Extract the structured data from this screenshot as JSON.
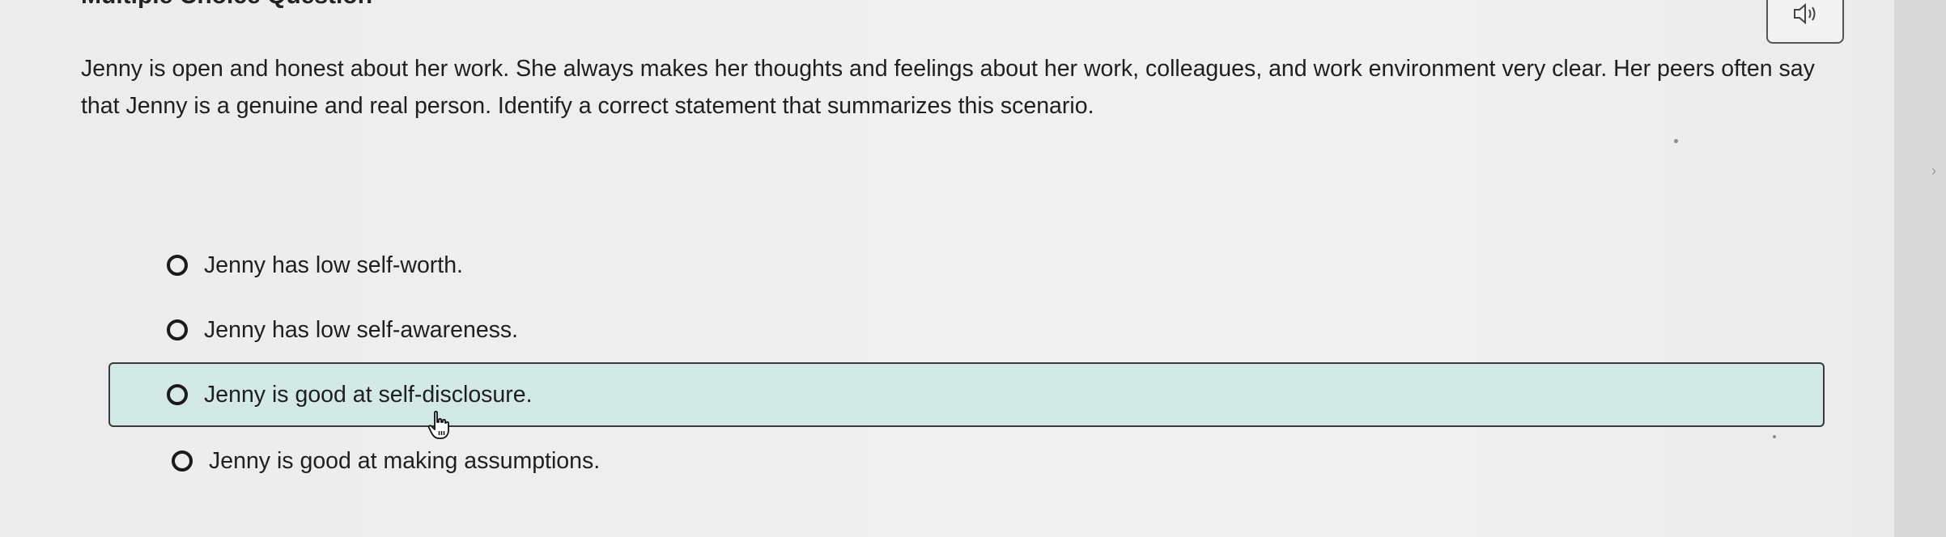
{
  "header": {
    "title": "Multiple Choice Question"
  },
  "audio": {
    "icon": "speaker-icon"
  },
  "question": {
    "text": "Jenny is open and honest about her work. She always makes her thoughts and feelings about her work, colleagues, and work environment very clear. Her peers often say that Jenny is a genuine and real person. Identify a correct statement that summarizes this scenario."
  },
  "choices": [
    {
      "label": "Jenny has low self-worth.",
      "selected": false,
      "hovered": false
    },
    {
      "label": "Jenny has low self-awareness.",
      "selected": false,
      "hovered": false
    },
    {
      "label": "Jenny is good at self-disclosure.",
      "selected": false,
      "hovered": true
    },
    {
      "label": "Jenny is good at making assumptions.",
      "selected": false,
      "hovered": false
    }
  ],
  "colors": {
    "highlight": "#d3e9e6",
    "text": "#1f1f1f",
    "background": "#efefef"
  }
}
